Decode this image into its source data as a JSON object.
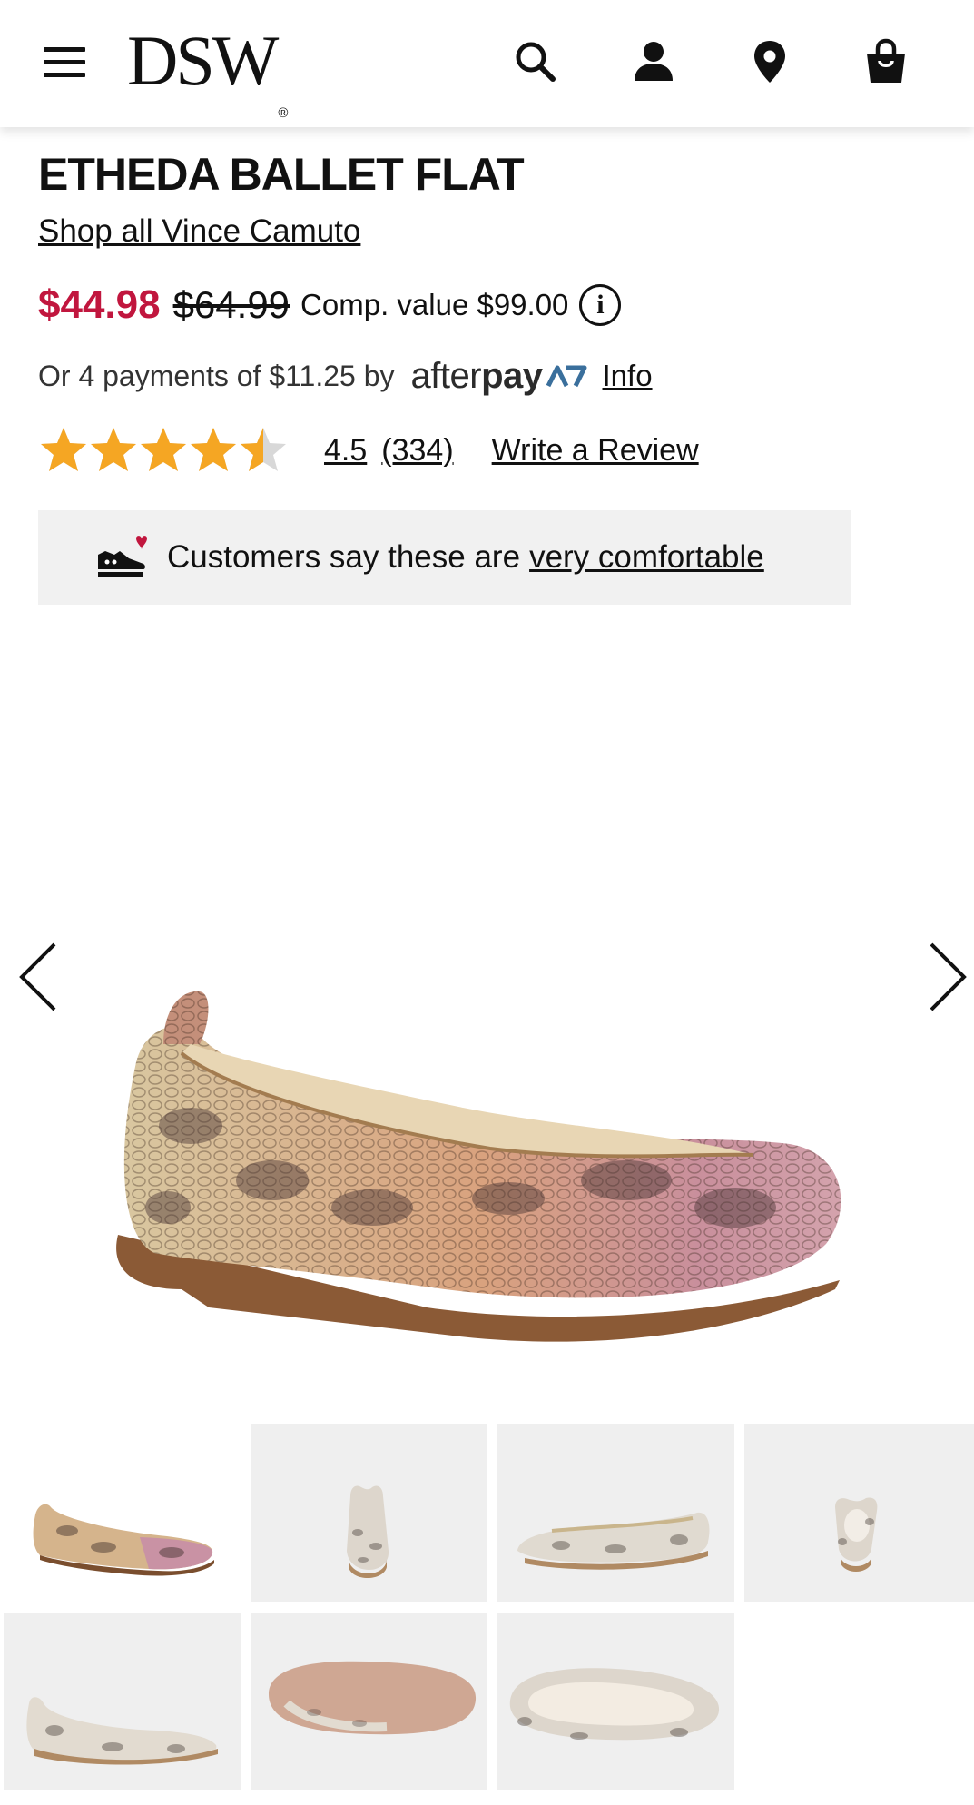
{
  "header": {
    "logo_text": "DSW",
    "logo_reg": "®",
    "icons": [
      "menu-icon",
      "search-icon",
      "account-icon",
      "store-locator-icon",
      "cart-icon"
    ]
  },
  "product": {
    "title": "ETHEDA BALLET FLAT",
    "brand_link": "Shop all Vince Camuto",
    "sale_price": "$44.98",
    "original_price": "$64.99",
    "comp_value": "Comp. value $99.00",
    "info_glyph": "i"
  },
  "afterpay": {
    "text": "Or 4 payments of $11.25 by",
    "logo_light": "after",
    "logo_bold": "pay",
    "info_link": "Info"
  },
  "rating": {
    "value": 4.5,
    "max": 5,
    "rating_text": "4.5",
    "count_text": "(334)",
    "write_review": "Write a Review"
  },
  "comfort": {
    "prefix": "Customers say these are",
    "link": "very comfortable"
  },
  "colors": {
    "sale_red": "#c1163e",
    "star_gold": "#f5a623",
    "star_empty": "#d8d8d8",
    "comfort_bg": "#f1f1f1",
    "afterpay_blue": "#3a6f9c"
  },
  "gallery": {
    "thumbnail_count": 7,
    "prev_icon": "chevron-left-icon",
    "next_icon": "chevron-right-icon"
  }
}
